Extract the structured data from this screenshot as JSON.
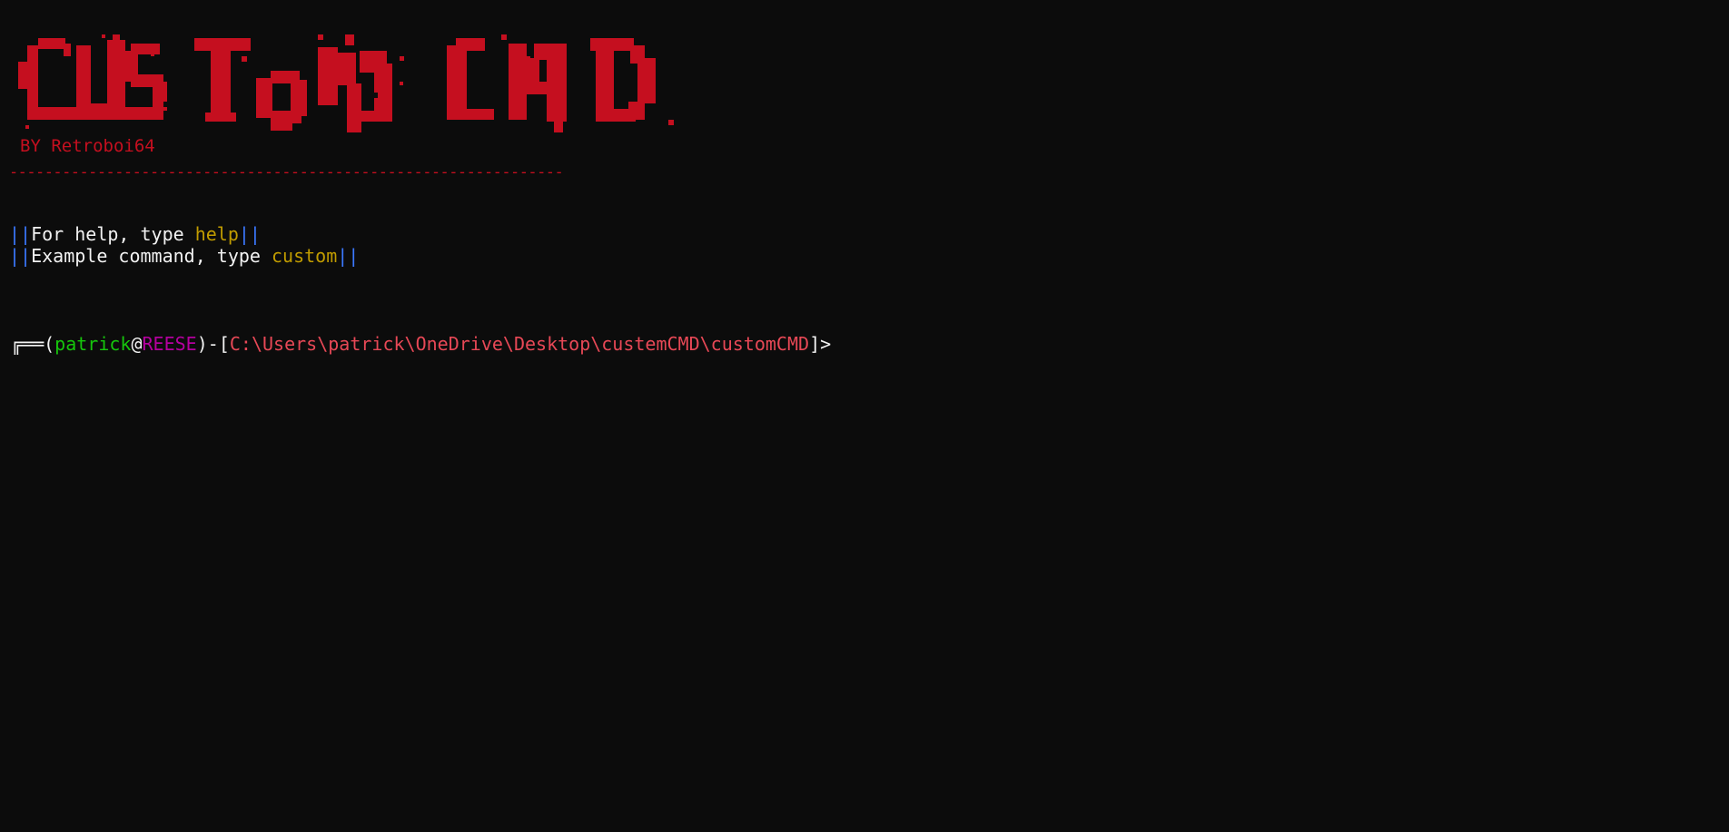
{
  "window": {
    "background": "#0c0c0c"
  },
  "banner": {
    "text": "CUSTOM CMD",
    "color": "#c50f1f"
  },
  "byline": "BY Retroboi64",
  "rule": "---------------------------------------------------------------",
  "hints": [
    {
      "bars_open": "||",
      "text": "For help, type ",
      "keyword": "help",
      "bars_close": "||"
    },
    {
      "bars_open": "||",
      "text": "Example command, type ",
      "keyword": "custom",
      "bars_close": "||"
    }
  ],
  "prompt": {
    "corner": "╔══",
    "open_paren": "(",
    "user": "patrick",
    "at": "@",
    "host": "REESE",
    "close_paren": ")",
    "dash": "-",
    "open_bracket": "[",
    "path": "C:\\Users\\patrick\\OneDrive\\Desktop\\custemCMD\\customCMD",
    "close_bracket": "]",
    "symbol": ">"
  },
  "colors": {
    "banner_red": "#c50f1f",
    "bar_blue": "#3b78ff",
    "keyword_yellow": "#c19c00",
    "user_green": "#16c60c",
    "host_purple": "#b4009e",
    "path_red": "#e74856",
    "text_white": "#f2f2f2"
  }
}
